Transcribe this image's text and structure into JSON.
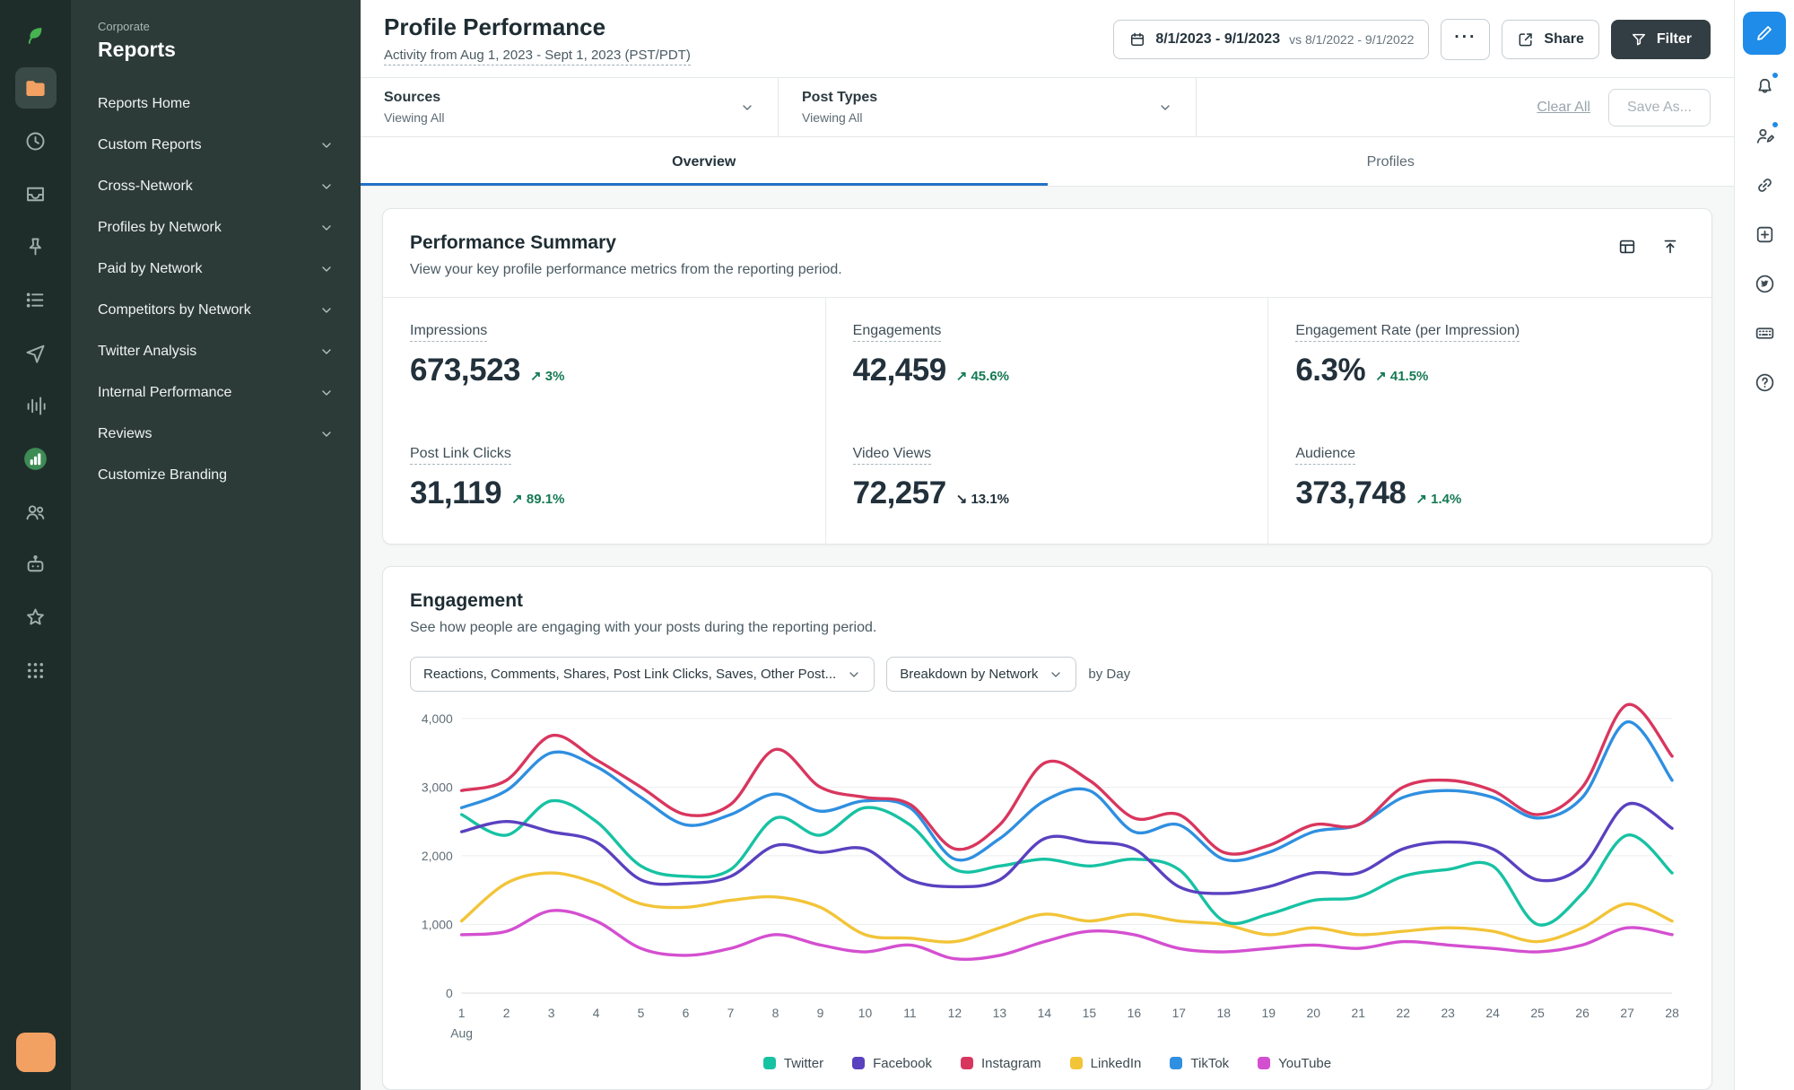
{
  "sidebar": {
    "eyebrow": "Corporate",
    "title": "Reports",
    "items": [
      {
        "label": "Reports Home",
        "expandable": false
      },
      {
        "label": "Custom Reports",
        "expandable": true
      },
      {
        "label": "Cross-Network",
        "expandable": true
      },
      {
        "label": "Profiles by Network",
        "expandable": true
      },
      {
        "label": "Paid by Network",
        "expandable": true
      },
      {
        "label": "Competitors by Network",
        "expandable": true
      },
      {
        "label": "Twitter Analysis",
        "expandable": true
      },
      {
        "label": "Internal Performance",
        "expandable": true
      },
      {
        "label": "Reviews",
        "expandable": true
      },
      {
        "label": "Customize Branding",
        "expandable": false
      }
    ]
  },
  "rail_icons": [
    "sprout-logo",
    "folder",
    "clock",
    "inbox",
    "pin",
    "queue",
    "send",
    "waveform",
    "bar-chart",
    "users",
    "bot",
    "star",
    "apps",
    "avatar"
  ],
  "right_rail_icons": [
    "compose",
    "notifications",
    "assist",
    "link",
    "new-item",
    "twitter",
    "keyboard",
    "help"
  ],
  "header": {
    "title": "Profile Performance",
    "subtitle": "Activity from Aug 1, 2023 - Sept 1, 2023 (PST/PDT)",
    "date_range": "8/1/2023 - 9/1/2023",
    "date_compare": "vs 8/1/2022 - 9/1/2022",
    "more_label": "···",
    "share_label": "Share",
    "filter_label": "Filter"
  },
  "filters": {
    "sources_label": "Sources",
    "sources_value": "Viewing All",
    "post_types_label": "Post Types",
    "post_types_value": "Viewing All",
    "clear_all_label": "Clear All",
    "save_as_label": "Save As..."
  },
  "tabs": [
    {
      "label": "Overview",
      "active": true
    },
    {
      "label": "Profiles",
      "active": false
    }
  ],
  "summary": {
    "title": "Performance Summary",
    "subtitle": "View your key profile performance metrics from the reporting period.",
    "metrics": [
      {
        "label": "Impressions",
        "value": "673,523",
        "arrow": "↗",
        "delta": "3%",
        "direction": "up"
      },
      {
        "label": "Engagements",
        "value": "42,459",
        "arrow": "↗",
        "delta": "45.6%",
        "direction": "up"
      },
      {
        "label": "Engagement Rate (per Impression)",
        "value": "6.3%",
        "arrow": "↗",
        "delta": "41.5%",
        "direction": "up"
      },
      {
        "label": "Post Link Clicks",
        "value": "31,119",
        "arrow": "↗",
        "delta": "89.1%",
        "direction": "up"
      },
      {
        "label": "Video Views",
        "value": "72,257",
        "arrow": "↘",
        "delta": "13.1%",
        "direction": "down"
      },
      {
        "label": "Audience",
        "value": "373,748",
        "arrow": "↗",
        "delta": "1.4%",
        "direction": "up"
      }
    ]
  },
  "engagement": {
    "title": "Engagement",
    "subtitle": "See how people are engaging with your posts during the reporting period.",
    "metric_filter": "Reactions, Comments, Shares, Post Link Clicks, Saves, Other Post...",
    "breakdown_filter": "Breakdown by Network",
    "granularity": "by Day"
  },
  "chart_data": {
    "type": "line",
    "title": "Engagement by Day",
    "x": [
      1,
      2,
      3,
      4,
      5,
      6,
      7,
      8,
      9,
      10,
      11,
      12,
      13,
      14,
      15,
      16,
      17,
      18,
      19,
      20,
      21,
      22,
      23,
      24,
      25,
      26,
      27,
      28
    ],
    "xlabel": "Aug",
    "ylim": [
      0,
      4000
    ],
    "ytick_labels": [
      "0",
      "1,000",
      "2,000",
      "3,000",
      "4,000"
    ],
    "grid": "horizontal",
    "legend_position": "bottom",
    "series": [
      {
        "name": "Twitter",
        "color": "#17c2a3",
        "values": [
          2600,
          2300,
          2800,
          2500,
          1850,
          1700,
          1800,
          2550,
          2300,
          2700,
          2450,
          1800,
          1850,
          1950,
          1850,
          1950,
          1800,
          1050,
          1150,
          1350,
          1400,
          1700,
          1800,
          1850,
          1000,
          1450,
          2300,
          1750
        ]
      },
      {
        "name": "Facebook",
        "color": "#5a41c0",
        "values": [
          2350,
          2500,
          2350,
          2200,
          1650,
          1600,
          1700,
          2150,
          2050,
          2100,
          1650,
          1550,
          1650,
          2250,
          2200,
          2100,
          1550,
          1450,
          1550,
          1750,
          1750,
          2100,
          2200,
          2100,
          1650,
          1850,
          2750,
          2400
        ]
      },
      {
        "name": "Instagram",
        "color": "#d9365e",
        "values": [
          2950,
          3100,
          3750,
          3400,
          3000,
          2600,
          2750,
          3550,
          3000,
          2850,
          2750,
          2100,
          2450,
          3350,
          3100,
          2550,
          2600,
          2050,
          2150,
          2450,
          2450,
          3000,
          3100,
          2950,
          2600,
          3000,
          4200,
          3450
        ]
      },
      {
        "name": "LinkedIn",
        "color": "#f2c438",
        "values": [
          1050,
          1600,
          1750,
          1600,
          1300,
          1250,
          1350,
          1400,
          1250,
          850,
          800,
          750,
          950,
          1150,
          1050,
          1150,
          1050,
          1000,
          850,
          950,
          850,
          900,
          950,
          900,
          750,
          950,
          1300,
          1050
        ]
      },
      {
        "name": "TikTok",
        "color": "#2f8fe0",
        "values": [
          2700,
          2950,
          3500,
          3300,
          2850,
          2450,
          2600,
          2900,
          2650,
          2800,
          2700,
          1950,
          2250,
          2800,
          2950,
          2350,
          2450,
          1950,
          2050,
          2350,
          2450,
          2850,
          2950,
          2850,
          2550,
          2850,
          3950,
          3100
        ]
      },
      {
        "name": "YouTube",
        "color": "#d44fd0",
        "values": [
          850,
          900,
          1200,
          1050,
          650,
          550,
          650,
          850,
          700,
          600,
          700,
          500,
          550,
          750,
          900,
          850,
          650,
          600,
          650,
          700,
          650,
          750,
          700,
          650,
          600,
          700,
          950,
          850
        ]
      }
    ]
  }
}
